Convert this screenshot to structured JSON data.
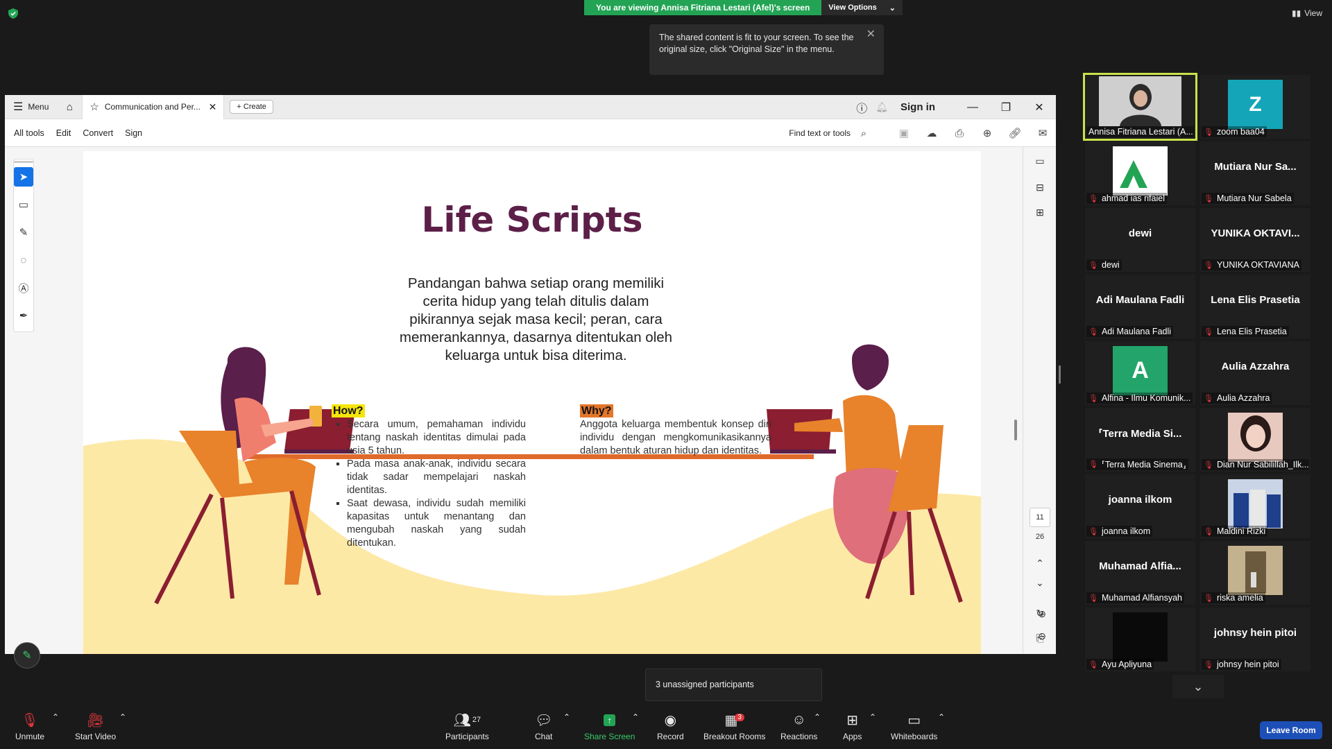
{
  "banner": {
    "viewing_text": "You are viewing Annisa Fitriana Lestari (Afel)'s screen",
    "view_options": "View Options"
  },
  "toast": {
    "text": "The shared content is fit to your screen. To see the original size, click \"Original Size\" in the menu."
  },
  "top_right": {
    "view_label": "View"
  },
  "acrobat": {
    "menu_label": "Menu",
    "tab_title": "Communication and Per...",
    "create_label": "Create",
    "sign_in": "Sign in",
    "toolbar": {
      "all_tools": "All tools",
      "edit": "Edit",
      "convert": "Convert",
      "sign": "Sign",
      "find": "Find text or tools"
    },
    "page_current": "11",
    "page_total": "26"
  },
  "slide": {
    "title": "Life Scripts",
    "subtitle": "Pandangan bahwa setiap orang memiliki cerita hidup yang telah ditulis dalam pikirannya sejak masa kecil; peran, cara memerankannya, dasarnya ditentukan oleh keluarga untuk bisa diterima.",
    "how_head": "How?",
    "how_items": [
      "Secara umum, pemahaman individu tentang naskah identitas dimulai pada usia 5 tahun.",
      "Pada masa anak-anak, individu secara tidak sadar mempelajari naskah identitas.",
      "Saat dewasa, individu sudah memiliki kapasitas untuk menantang dan mengubah naskah yang sudah ditentukan."
    ],
    "why_head": "Why?",
    "why_text": "Anggota keluarga membentuk konsep diri individu dengan mengkomunikasikannya dalam bentuk aturan hidup dan identitas.",
    "colors": {
      "title": "#5c1f48",
      "how_bg": "#f5e60a",
      "why_bg": "#e2762a",
      "wave": "#fde9a6",
      "chair": "#e8822b",
      "table": "#e06a2b"
    }
  },
  "participants": [
    {
      "big": "",
      "label": "Annisa Fitriana Lestari (A...",
      "muted": false,
      "kind": "video-woman"
    },
    {
      "big": "Z",
      "label": "zoom baa04",
      "muted": true,
      "kind": "avatar-teal"
    },
    {
      "big": "",
      "label": "ahmad ias rifaiel",
      "muted": true,
      "kind": "logo"
    },
    {
      "big": "Mutiara Nur Sa...",
      "label": "Mutiara Nur Sabela",
      "muted": true,
      "kind": "name"
    },
    {
      "big": "dewi",
      "label": "dewi",
      "muted": true,
      "kind": "name"
    },
    {
      "big": "YUNIKA OKTAVI...",
      "label": "YUNIKA OKTAVIANA",
      "muted": true,
      "kind": "name"
    },
    {
      "big": "Adi Maulana Fadli",
      "label": "Adi Maulana Fadli",
      "muted": true,
      "kind": "name"
    },
    {
      "big": "Lena Elis Prasetia",
      "label": "Lena Elis Prasetia",
      "muted": true,
      "kind": "name"
    },
    {
      "big": "A",
      "label": "Alfina - Ilmu Komunik...",
      "muted": true,
      "kind": "avatar-green"
    },
    {
      "big": "Aulia Azzahra",
      "label": "Aulia Azzahra",
      "muted": true,
      "kind": "name"
    },
    {
      "big": "⸢Terra Media Si...",
      "label": "⸢Terra Media Sinema⸥",
      "muted": true,
      "kind": "name"
    },
    {
      "big": "",
      "label": "Dian Nur Sabilillah_Ilk...",
      "muted": true,
      "kind": "photo-girl"
    },
    {
      "big": "joanna ilkom",
      "label": "joanna ilkom",
      "muted": true,
      "kind": "name"
    },
    {
      "big": "",
      "label": "Maldini Rizki",
      "muted": true,
      "kind": "photo-group"
    },
    {
      "big": "Muhamad Alfia...",
      "label": "Muhamad Alfiansyah",
      "muted": true,
      "kind": "name"
    },
    {
      "big": "",
      "label": "riska amelia",
      "muted": true,
      "kind": "photo-room"
    },
    {
      "big": "",
      "label": "Ayu Apliyuna",
      "muted": true,
      "kind": "black"
    },
    {
      "big": "johnsy hein pitoi",
      "label": "johnsy hein pitoi",
      "muted": true,
      "kind": "name"
    }
  ],
  "unassigned": "3 unassigned participants",
  "bottom": {
    "unmute": "Unmute",
    "start_video": "Start Video",
    "participants": "Participants",
    "participants_count": "27",
    "chat": "Chat",
    "share": "Share Screen",
    "record": "Record",
    "breakout": "Breakout Rooms",
    "breakout_badge": "3",
    "reactions": "Reactions",
    "apps": "Apps",
    "whiteboards": "Whiteboards",
    "leave": "Leave Room"
  }
}
